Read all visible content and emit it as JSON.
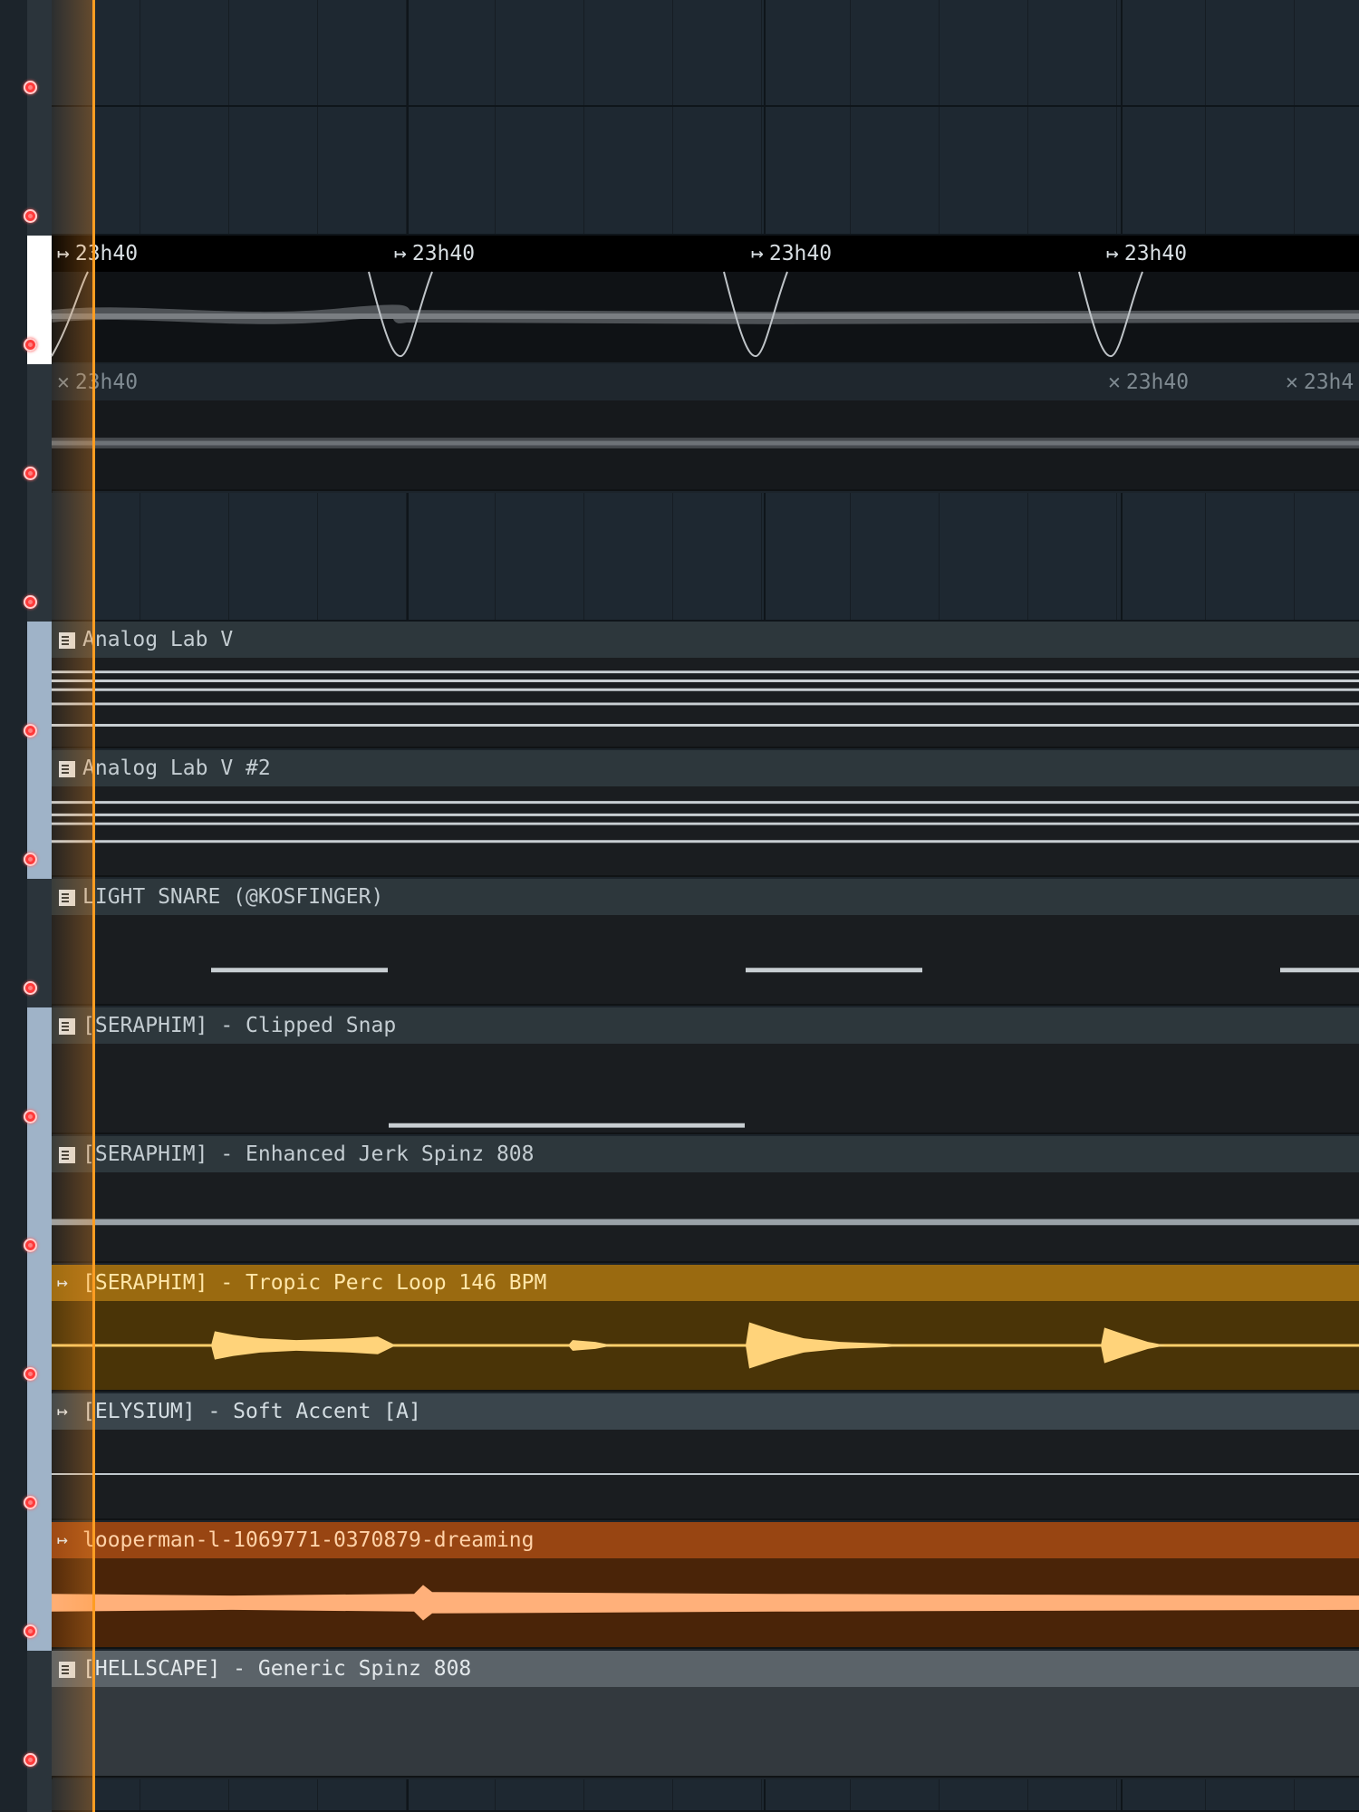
{
  "theme": {
    "playhead_color": "#ff9d22",
    "gold_clip": "#9a6a10",
    "orange_clip": "#984512",
    "track_selected": "#9fb3c8"
  },
  "tracks": [
    {
      "type": "empty"
    },
    {
      "type": "empty"
    },
    {
      "type": "audio",
      "style": "black",
      "selected": "white",
      "markers": [
        {
          "label": "23h40",
          "icon": "loop-arrow-icon"
        },
        {
          "label": "23h40",
          "icon": "loop-arrow-icon"
        },
        {
          "label": "23h40",
          "icon": "loop-arrow-icon"
        },
        {
          "label": "23h40",
          "icon": "loop-arrow-icon"
        }
      ]
    },
    {
      "type": "audio",
      "style": "dark2",
      "markers": [
        {
          "label": "23h40",
          "icon": "close-x-icon"
        },
        {
          "label": "23h40",
          "icon": "close-x-icon"
        },
        {
          "label": "23h4",
          "icon": "close-x-icon"
        }
      ]
    },
    {
      "type": "empty"
    },
    {
      "type": "pattern",
      "name": "Analog Lab V",
      "style": "plain",
      "selected": true,
      "icon": "piano-roll-icon"
    },
    {
      "type": "pattern",
      "name": "Analog Lab V #2",
      "style": "plain",
      "selected": true,
      "icon": "piano-roll-icon"
    },
    {
      "type": "pattern",
      "name": "LIGHT SNARE (@KOSFINGER)",
      "style": "plain",
      "selected": false,
      "icon": "piano-roll-icon"
    },
    {
      "type": "pattern",
      "name": "[SERAPHIM] - Clipped Snap",
      "style": "plain",
      "selected": true,
      "icon": "piano-roll-icon"
    },
    {
      "type": "pattern",
      "name": "[SERAPHIM] - Enhanced Jerk Spinz 808",
      "style": "plain",
      "selected": true,
      "icon": "piano-roll-icon"
    },
    {
      "type": "audio",
      "name": "[SERAPHIM] - Tropic Perc Loop 146 BPM",
      "style": "gold",
      "selected": true,
      "icon": "audio-clip-icon"
    },
    {
      "type": "audio",
      "name": "[ELYSIUM] - Soft Accent [A]",
      "style": "slate",
      "selected": true,
      "icon": "audio-clip-icon"
    },
    {
      "type": "audio",
      "name": "looperman-l-1069771-0370879-dreaming",
      "style": "orange",
      "selected": true,
      "icon": "audio-clip-icon"
    },
    {
      "type": "pattern",
      "name": "[HELLSCAPE] - Generic Spinz 808",
      "style": "greyc",
      "selected": false,
      "icon": "piano-roll-icon"
    },
    {
      "type": "empty"
    }
  ]
}
